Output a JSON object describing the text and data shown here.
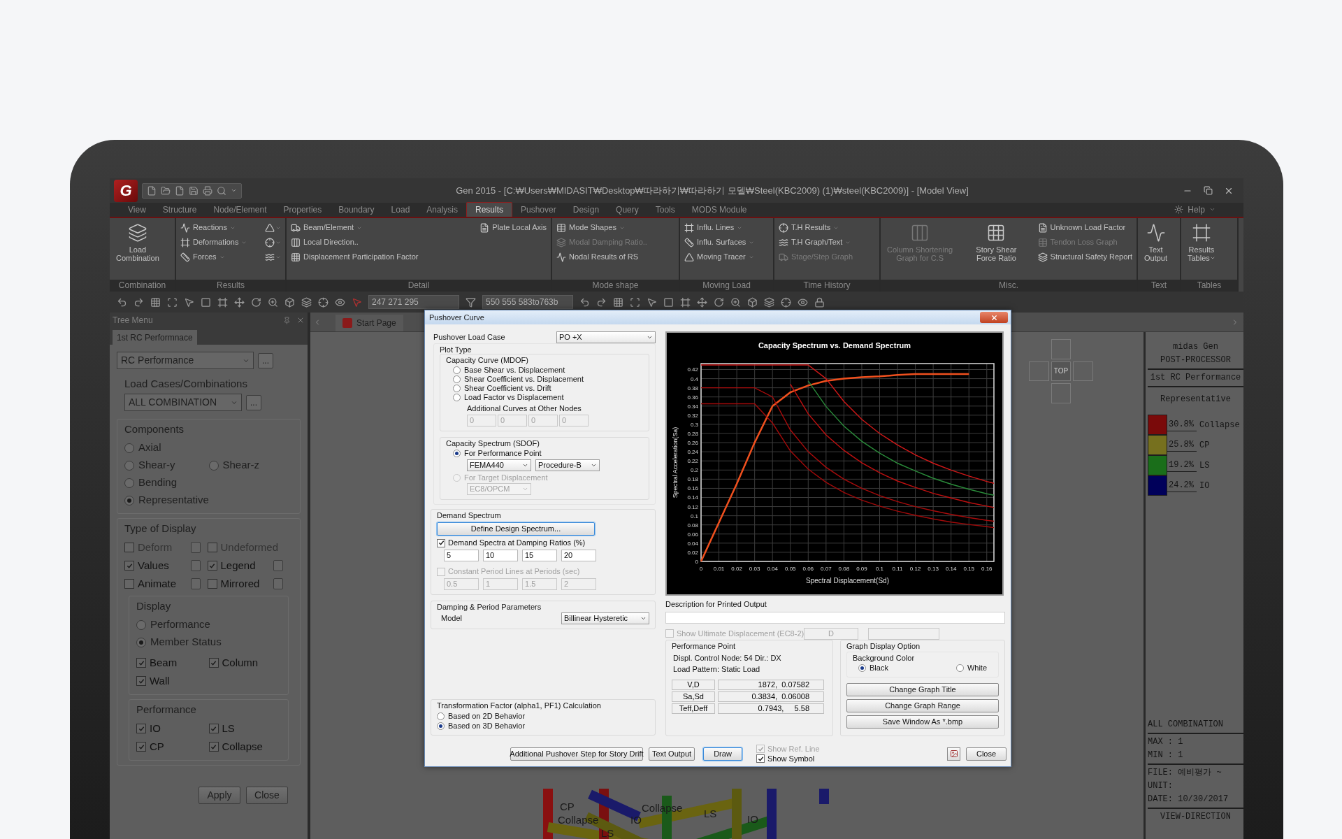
{
  "window": {
    "logo": "G",
    "title": "Gen 2015 - [C:₩Users₩MIDASIT₩Desktop₩따라하기₩따라하기 모델₩Steel(KBC2009) (1)₩steel(KBC2009)] - [Model View]",
    "help": "Help"
  },
  "menu_tabs": [
    {
      "label": "View",
      "selected": false
    },
    {
      "label": "Structure",
      "selected": false
    },
    {
      "label": "Node/Element",
      "selected": false
    },
    {
      "label": "Properties",
      "selected": false
    },
    {
      "label": "Boundary",
      "selected": false
    },
    {
      "label": "Load",
      "selected": false
    },
    {
      "label": "Analysis",
      "selected": false
    },
    {
      "label": "Results",
      "selected": true
    },
    {
      "label": "Pushover",
      "selected": false
    },
    {
      "label": "Design",
      "selected": false
    },
    {
      "label": "Query",
      "selected": false
    },
    {
      "label": "Tools",
      "selected": false
    },
    {
      "label": "MODS Module",
      "selected": false
    }
  ],
  "ribbon": [
    {
      "label": "Combination",
      "columns": [
        [
          {
            "kind": "large",
            "lines": [
              "Load",
              "Combination"
            ],
            "dropdown": false,
            "disabled": false
          }
        ]
      ]
    },
    {
      "label": "Results",
      "columns": [
        [
          {
            "kind": "small",
            "label": "Reactions",
            "dropdown": true,
            "disabled": false
          },
          {
            "kind": "small",
            "label": "Deformations",
            "dropdown": true,
            "disabled": false
          },
          {
            "kind": "small",
            "label": "Forces",
            "dropdown": true,
            "disabled": false
          }
        ],
        [
          {
            "kind": "icon",
            "dropdown": true,
            "disabled": false
          },
          {
            "kind": "icon",
            "dropdown": true,
            "disabled": false
          },
          {
            "kind": "icon",
            "dropdown": true,
            "disabled": false
          }
        ]
      ]
    },
    {
      "label": "Detail",
      "columns": [
        [
          {
            "kind": "small",
            "label": "Beam/Element",
            "dropdown": true,
            "disabled": false
          },
          {
            "kind": "small",
            "label": "Local Direction..",
            "dropdown": false,
            "disabled": false
          },
          {
            "kind": "small",
            "label": "Displacement Participation Factor",
            "dropdown": false,
            "disabled": false
          }
        ],
        [
          {
            "kind": "small",
            "label": "Plate Local Axis",
            "dropdown": false,
            "disabled": false
          }
        ]
      ]
    },
    {
      "label": "Mode shape",
      "columns": [
        [
          {
            "kind": "small",
            "label": "Mode Shapes",
            "dropdown": true,
            "disabled": false
          },
          {
            "kind": "small",
            "label": "Modal Damping Ratio..",
            "dropdown": false,
            "disabled": true
          },
          {
            "kind": "small",
            "label": "Nodal Results of RS",
            "dropdown": false,
            "disabled": false
          }
        ]
      ]
    },
    {
      "label": "Moving Load",
      "columns": [
        [
          {
            "kind": "small",
            "label": "Influ. Lines",
            "dropdown": true,
            "disabled": false
          },
          {
            "kind": "small",
            "label": "Influ. Surfaces",
            "dropdown": true,
            "disabled": false
          },
          {
            "kind": "small",
            "label": "Moving Tracer",
            "dropdown": true,
            "disabled": false
          }
        ]
      ]
    },
    {
      "label": "Time History",
      "columns": [
        [
          {
            "kind": "small",
            "label": "T.H Results",
            "dropdown": true,
            "disabled": false
          },
          {
            "kind": "small",
            "label": "T.H Graph/Text",
            "dropdown": true,
            "disabled": false
          },
          {
            "kind": "small",
            "label": "Stage/Step Graph",
            "dropdown": false,
            "disabled": true
          }
        ]
      ]
    },
    {
      "label": "Misc.",
      "columns": [
        [
          {
            "kind": "large",
            "lines": [
              "Column Shortening",
              "Graph for C.S"
            ],
            "dropdown": false,
            "disabled": true
          }
        ],
        [
          {
            "kind": "large",
            "lines": [
              "Story Shear",
              "Force Ratio"
            ],
            "dropdown": false,
            "disabled": false
          }
        ],
        [
          {
            "kind": "small",
            "label": "Unknown Load Factor",
            "dropdown": false,
            "disabled": false
          },
          {
            "kind": "small",
            "label": "Tendon Loss Graph",
            "dropdown": false,
            "disabled": true
          },
          {
            "kind": "small",
            "label": "Structural Safety Report",
            "dropdown": false,
            "disabled": false
          }
        ]
      ]
    },
    {
      "label": "Text",
      "columns": [
        [
          {
            "kind": "large",
            "lines": [
              "Text",
              "Output"
            ],
            "dropdown": false,
            "disabled": false
          }
        ]
      ]
    },
    {
      "label": "Tables",
      "columns": [
        [
          {
            "kind": "large",
            "lines": [
              "Results",
              "Tables"
            ],
            "dropdown": true,
            "disabled": false
          }
        ]
      ]
    }
  ],
  "toolbar": {
    "fields": [
      "247 271 295",
      "550 555 583to763b"
    ]
  },
  "tree_menu": {
    "title": "Tree Menu",
    "tab": "1st RC Performnace",
    "result_type": "RC Performance",
    "more_button": "...",
    "load_cases_label": "Load Cases/Combinations",
    "load_case": "ALL COMBINATION",
    "load_case_button": "...",
    "components": {
      "label": "Components",
      "options": [
        {
          "label": "Axial",
          "selected": false
        },
        {
          "label": "Shear-y",
          "selected": false
        },
        {
          "label": "Shear-z",
          "selected": false
        },
        {
          "label": "Bending",
          "selected": false
        },
        {
          "label": "Representative",
          "selected": true
        }
      ]
    },
    "type_of_display": {
      "label": "Type of Display",
      "options": [
        {
          "label": "Deform",
          "checked": false,
          "disabled": true,
          "button": true
        },
        {
          "label": "Undeformed",
          "checked": false,
          "disabled": true,
          "button": false
        },
        {
          "label": "Values",
          "checked": true,
          "disabled": false,
          "button": true
        },
        {
          "label": "Legend",
          "checked": true,
          "disabled": false,
          "button": true
        },
        {
          "label": "Animate",
          "checked": false,
          "disabled": false,
          "button": true
        },
        {
          "label": "Mirrored",
          "checked": false,
          "disabled": false,
          "button": true
        }
      ]
    },
    "display": {
      "label": "Display",
      "options": [
        {
          "label": "Performance",
          "selected": false
        },
        {
          "label": "Member Status",
          "selected": true
        }
      ],
      "members": [
        {
          "label": "Beam",
          "checked": true
        },
        {
          "label": "Column",
          "checked": true
        },
        {
          "label": "Wall",
          "checked": true
        }
      ]
    },
    "performance": {
      "label": "Performance",
      "options": [
        {
          "label": "IO",
          "checked": true
        },
        {
          "label": "LS",
          "checked": true
        },
        {
          "label": "CP",
          "checked": true
        },
        {
          "label": "Collapse",
          "checked": true
        }
      ]
    },
    "buttons": [
      "Apply",
      "Close"
    ]
  },
  "canvas": {
    "tabs": [
      {
        "label": "Start Page"
      }
    ],
    "view_cube": {
      "label": "TOP"
    },
    "model_labels": [
      "CP",
      "Collapse",
      "IO",
      "LS",
      "Collapse",
      "LS",
      "IO"
    ]
  },
  "legend_panel": {
    "header": [
      "midas Gen",
      "POST-PROCESSOR"
    ],
    "title": "1st RC Performance",
    "component": "Representative",
    "rows": [
      {
        "color": "#7a0a0a",
        "percent": "30.8%",
        "label": "Collapse"
      },
      {
        "color": "#76701e",
        "percent": "25.8%",
        "label": "CP"
      },
      {
        "color": "#1a6e1a",
        "percent": "19.2%",
        "label": "LS"
      },
      {
        "color": "#00005a",
        "percent": "24.2%",
        "label": "IO"
      }
    ],
    "load_case": "ALL COMBINATION",
    "range": [
      "MAX : 1",
      "MIN : 1"
    ],
    "info": [
      "FILE: 예비평가 ~",
      "UNIT:",
      "DATE: 10/30/2017"
    ],
    "view_direction": "VIEW-DIRECTION"
  },
  "dialog": {
    "title": "Pushover Curve",
    "load_case_label": "Pushover Load Case",
    "load_case": "PO +X",
    "plot_type_label": "Plot Type",
    "capacity_curve": {
      "label": "Capacity Curve (MDOF)",
      "options": [
        {
          "label": "Base Shear vs. Displacement",
          "selected": false
        },
        {
          "label": "Shear Coefficient vs. Displacement",
          "selected": false
        },
        {
          "label": "Shear Coefficient vs. Drift",
          "selected": false
        },
        {
          "label": "Load Factor vs Displacement",
          "selected": false
        }
      ],
      "additional_label": "Additional Curves at Other Nodes",
      "additional_nodes": [
        "0",
        "0",
        "0",
        "0"
      ]
    },
    "capacity_spectrum": {
      "label": "Capacity Spectrum (SDOF)",
      "options": [
        {
          "label": "For Performance Point",
          "selected": true,
          "disabled": false
        },
        {
          "label": "For Target Displacement",
          "selected": false,
          "disabled": true
        }
      ],
      "method": "FEMA440",
      "procedure": "Procedure-B",
      "target_method": "EC8/OPCM"
    },
    "demand": {
      "label": "Demand Spectrum",
      "define_button": {
        "label": "Define Design Spectrum...",
        "focused": true
      },
      "damping": {
        "label": "Demand Spectra at Damping Ratios (%)",
        "checked": true,
        "disabled": false,
        "values": [
          "5",
          "10",
          "15",
          "20"
        ]
      },
      "periods": {
        "label": "Constant Period Lines at Periods (sec)",
        "checked": false,
        "disabled": true,
        "values": [
          "0.5",
          "1",
          "1.5",
          "2"
        ]
      }
    },
    "damping_params": {
      "label": "Damping & Period Parameters",
      "model_label": "Model",
      "model": "Billinear Hysteretic"
    },
    "transformation": {
      "label": "Transformation Factor (alpha1, PF1) Calculation",
      "options": [
        {
          "label": "Based on 2D Behavior",
          "selected": false
        },
        {
          "label": "Based on 3D Behavior",
          "selected": true
        }
      ]
    },
    "chart": {
      "chart_data": {
        "type": "line",
        "title": "Capacity Spectrum vs. Demand Spectrum",
        "xlabel": "Spectral Displacement(Sd)",
        "ylabel": "Spectral Acceleration(Sa)",
        "x": [
          0,
          0.01,
          0.02,
          0.03,
          0.04,
          0.05,
          0.06,
          0.07,
          0.08,
          0.09,
          0.1,
          0.11,
          0.12,
          0.13,
          0.14,
          0.15,
          0.16,
          0.164
        ],
        "series": [
          {
            "color": "#f0501e",
            "values": [
              0,
              0.085,
              0.17,
              0.26,
              0.34,
              0.37,
              0.385,
              0.395,
              0.4,
              0.403,
              0.405,
              0.408,
              0.41,
              0.41,
              0.41,
              0.41,
              null,
              null
            ]
          },
          {
            "color": "#d01818",
            "values": [
              0.43,
              0.43,
              0.43,
              0.43,
              0.43,
              0.43,
              0.43,
              0.4,
              0.35,
              0.311,
              0.28,
              0.255,
              0.233,
              0.215,
              0.2,
              0.187,
              0.175,
              0.171
            ]
          },
          {
            "color": "#2a8a3a",
            "values": [
              null,
              null,
              null,
              null,
              null,
              null,
              0.395,
              0.339,
              0.296,
              0.263,
              0.237,
              0.215,
              0.198,
              0.182,
              0.169,
              0.158,
              0.148,
              0.145
            ]
          },
          {
            "color": "#c01010",
            "values": [
              null,
              null,
              null,
              null,
              null,
              0.388,
              0.323,
              0.277,
              0.243,
              0.216,
              0.194,
              0.176,
              0.162,
              0.149,
              0.139,
              0.129,
              0.121,
              0.118
            ]
          },
          {
            "color": "#a80c0c",
            "values": [
              0.38,
              0.38,
              0.38,
              0.38,
              0.36,
              0.288,
              0.24,
              0.206,
              0.18,
              0.16,
              0.144,
              0.131,
              0.12,
              0.111,
              0.103,
              0.096,
              0.09,
              0.088
            ]
          },
          {
            "color": "#a00a0a",
            "values": [
              0.345,
              0.345,
              0.345,
              0.345,
              0.303,
              0.242,
              0.202,
              0.173,
              0.151,
              0.134,
              0.121,
              0.11,
              0.101,
              0.093,
              0.086,
              0.081,
              0.076,
              0.074
            ]
          }
        ],
        "grid": true,
        "xlim": [
          0,
          0.164
        ],
        "ylim": [
          0,
          0.433
        ],
        "xticks": [
          0,
          0.01,
          0.02,
          0.03,
          0.04,
          0.05,
          0.06,
          0.07,
          0.08,
          0.09,
          0.1,
          0.11,
          0.12,
          0.13,
          0.14,
          0.15,
          0.16
        ],
        "yticks": [
          0,
          0.02,
          0.04,
          0.06,
          0.08,
          0.1,
          0.12,
          0.14,
          0.16,
          0.18,
          0.2,
          0.22,
          0.24,
          0.26,
          0.28,
          0.3,
          0.32,
          0.34,
          0.36,
          0.38,
          0.4,
          0.42
        ]
      }
    },
    "description_label": "Description for Printed Output",
    "ultimate": {
      "label": "Show Ultimate Displacement  (EC8-2)",
      "checked": false,
      "disabled": true,
      "field": "D"
    },
    "performance_point": {
      "label": "Performance Point",
      "lines": [
        "Displ. Control Node: 54  Dir.: DX",
        "Load Pattern: Static Load"
      ],
      "rows": [
        {
          "name": "V,D",
          "value": "1872,  0.07582"
        },
        {
          "name": "Sa,Sd",
          "value": "0.3834,  0.06008"
        },
        {
          "name": "Teff,Deff",
          "value": "0.7943,     5.58"
        }
      ]
    },
    "graph_options": {
      "label": "Graph Display Option",
      "bg_label": "Background Color",
      "bg_options": [
        {
          "label": "Black",
          "selected": true
        },
        {
          "label": "White",
          "selected": false
        }
      ],
      "buttons": [
        "Change Graph Title",
        "Change Graph Range",
        "Save Window As *.bmp"
      ]
    },
    "footer": {
      "buttons": [
        {
          "label": "Additional Pushover Step for Story Drift",
          "focused": false
        },
        {
          "label": "Text Output",
          "focused": false
        },
        {
          "label": "Draw",
          "focused": true
        }
      ],
      "checks": [
        {
          "label": "Show Ref. Line",
          "checked": true,
          "disabled": true
        },
        {
          "label": "Show Symbol",
          "checked": true,
          "disabled": false
        }
      ],
      "close": "Close"
    }
  }
}
